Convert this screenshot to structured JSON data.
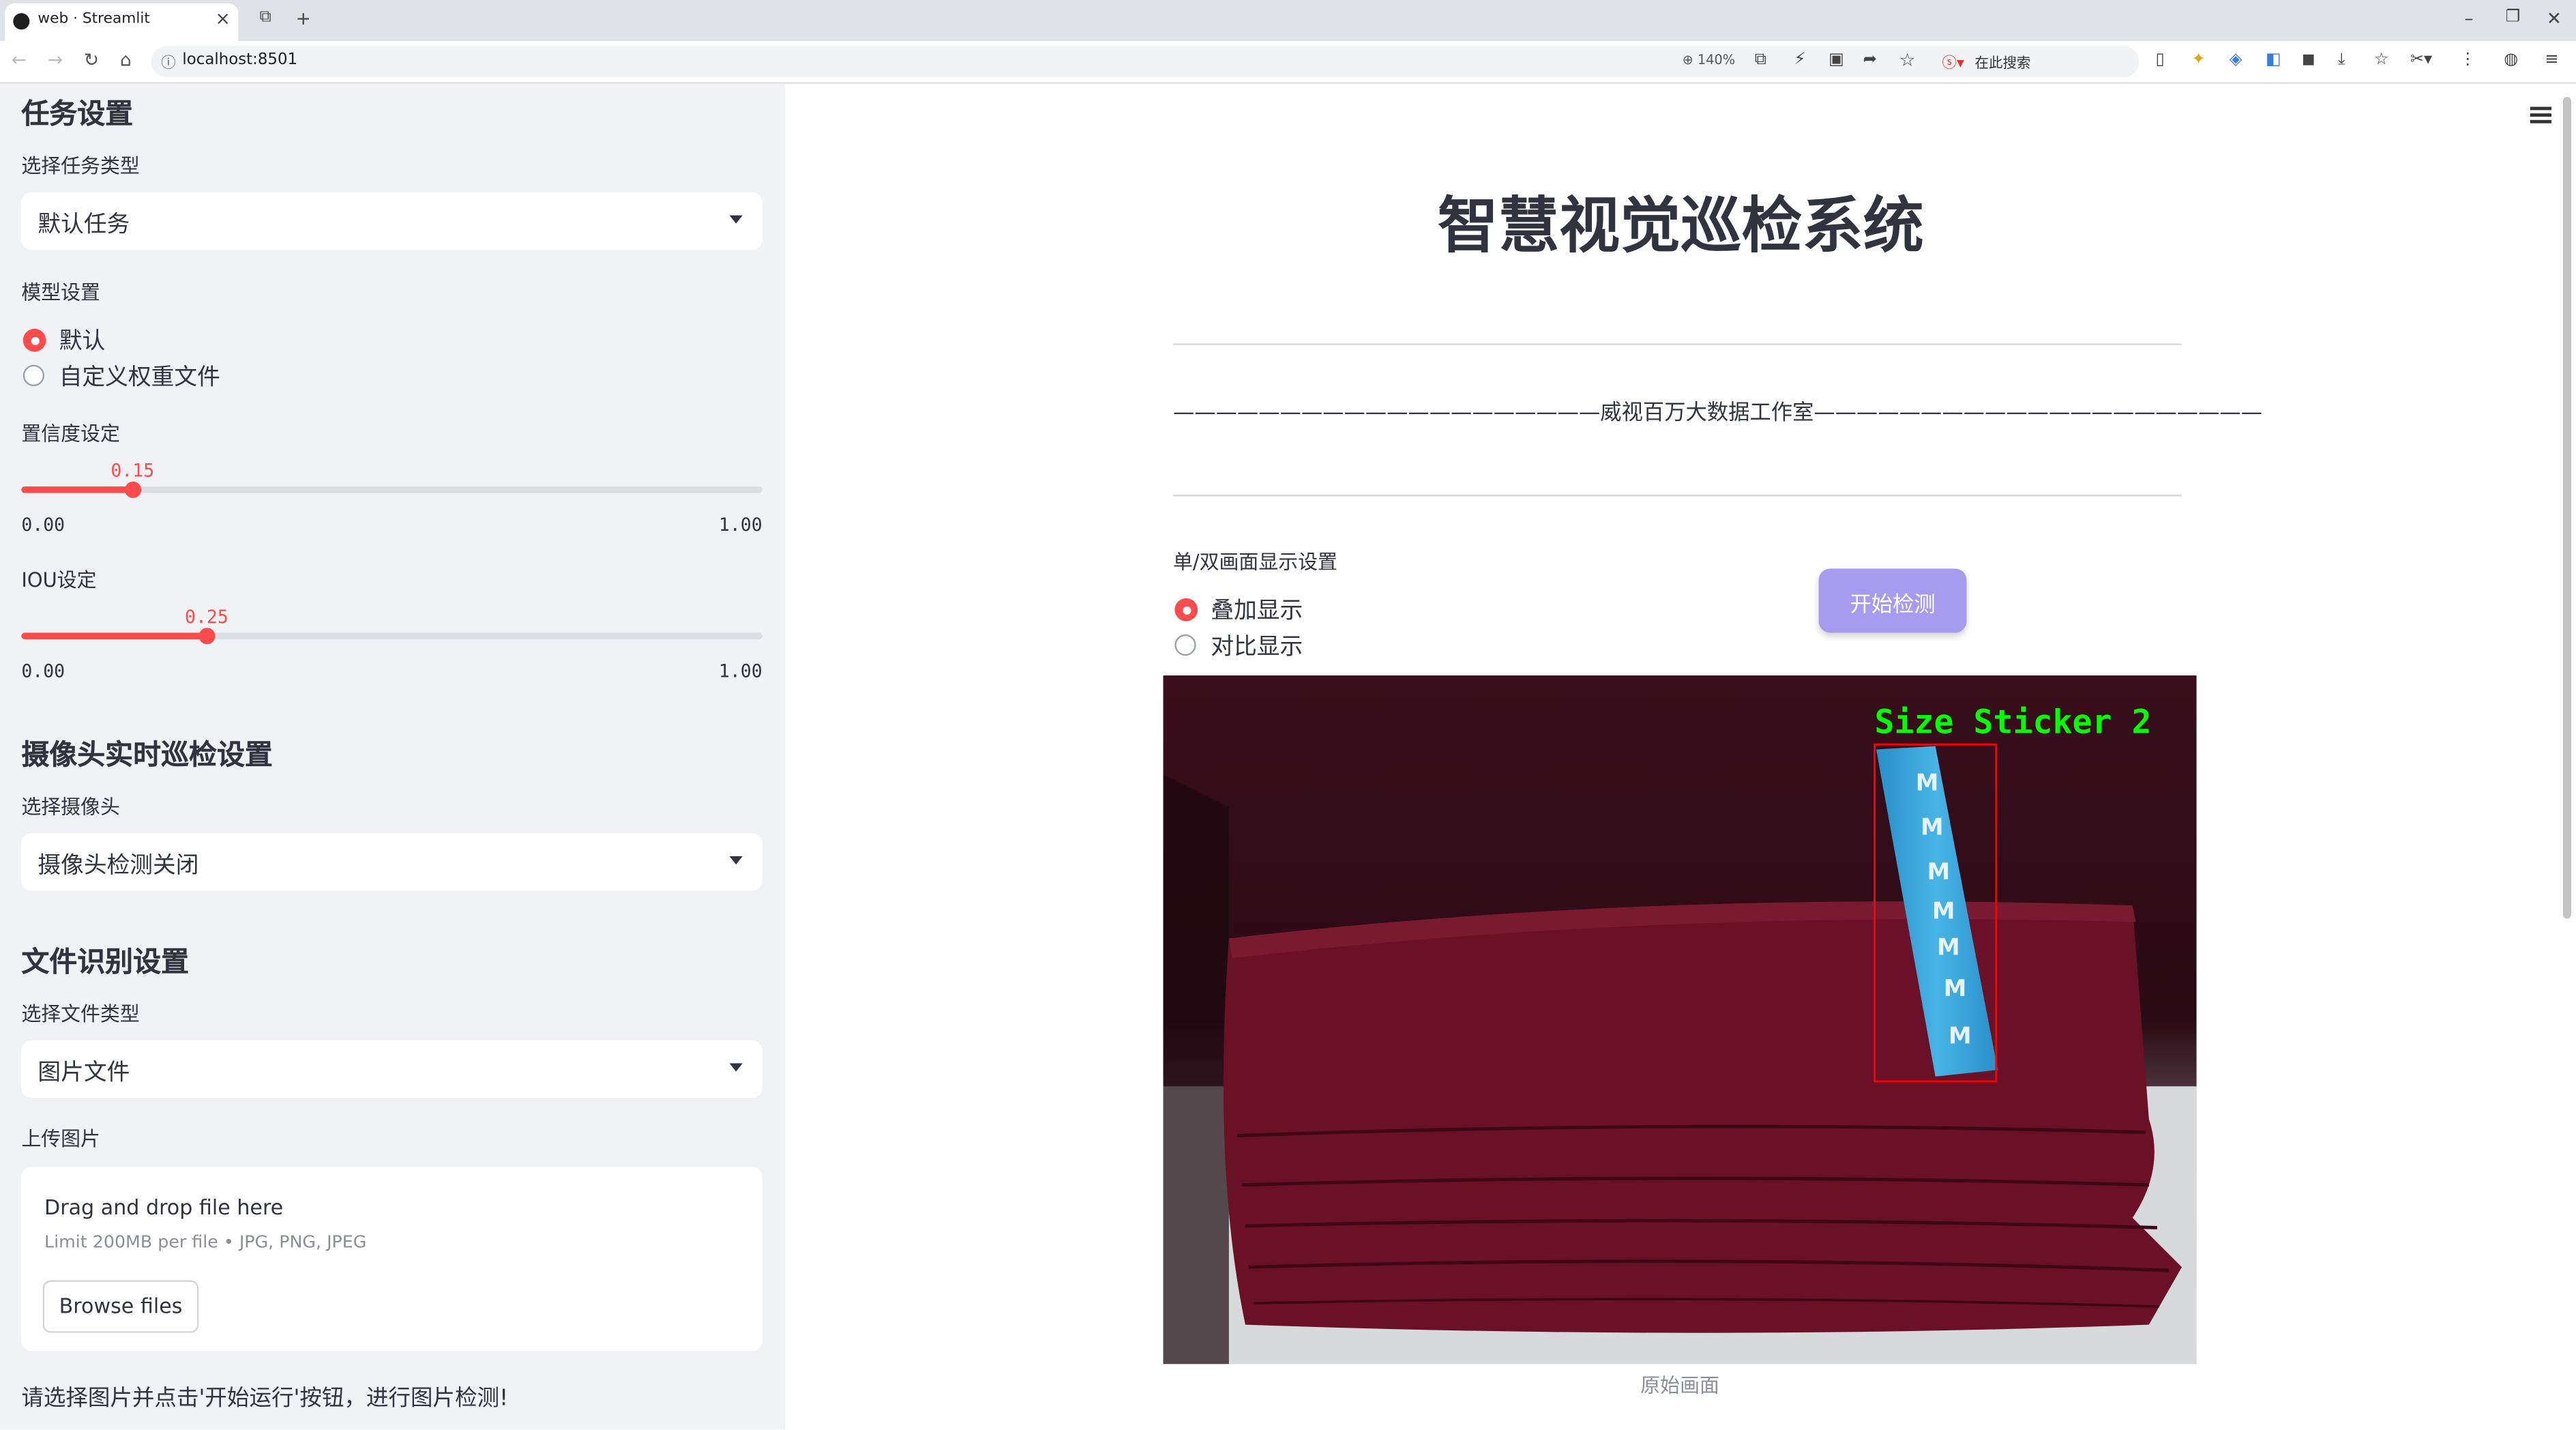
{
  "browser": {
    "tab_title": "web · Streamlit",
    "tab_close": "×",
    "new_tab": "+",
    "url": "localhost:8501",
    "zoom": "140%",
    "search_engine_label": "在此搜索"
  },
  "sidebar": {
    "task_section_title": "任务设置",
    "task_type_label": "选择任务类型",
    "task_type_value": "默认任务",
    "model_label": "模型设置",
    "model_options": [
      "默认",
      "自定义权重文件"
    ],
    "model_selected": "默认",
    "confidence": {
      "label": "置信度设定",
      "value": "0.15",
      "min": "0.00",
      "max": "1.00",
      "fraction": 0.15
    },
    "iou": {
      "label": "IOU设定",
      "value": "0.25",
      "min": "0.00",
      "max": "1.00",
      "fraction": 0.25
    },
    "camera_section_title": "摄像头实时巡检设置",
    "camera_label": "选择摄像头",
    "camera_value": "摄像头检测关闭",
    "file_section_title": "文件识别设置",
    "file_type_label": "选择文件类型",
    "file_type_value": "图片文件",
    "upload_label": "上传图片",
    "upload": {
      "drop_text": "Drag and drop file here",
      "limit_text": "Limit 200MB per file • JPG, PNG, JPEG",
      "browse_button": "Browse files"
    },
    "hint": "请选择图片并点击'开始运行'按钮，进行图片检测!"
  },
  "main": {
    "title": "智慧视觉巡检系统",
    "subtitle": "————————————————————威视百万大数据工作室—————————————————————",
    "display_label": "单/双画面显示设置",
    "display_options": [
      "叠加显示",
      "对比显示"
    ],
    "display_selected": "叠加显示",
    "start_button": "开始检测",
    "detection_label": "Size Sticker 2",
    "sticker_letter": "M",
    "caption": "原始画面"
  },
  "colors": {
    "accent": "#ff4b4b",
    "button": "#a79bf0",
    "sidebar_bg": "#f0f2f6",
    "detection_text": "#00ff00",
    "detection_box": "#ff0000"
  }
}
